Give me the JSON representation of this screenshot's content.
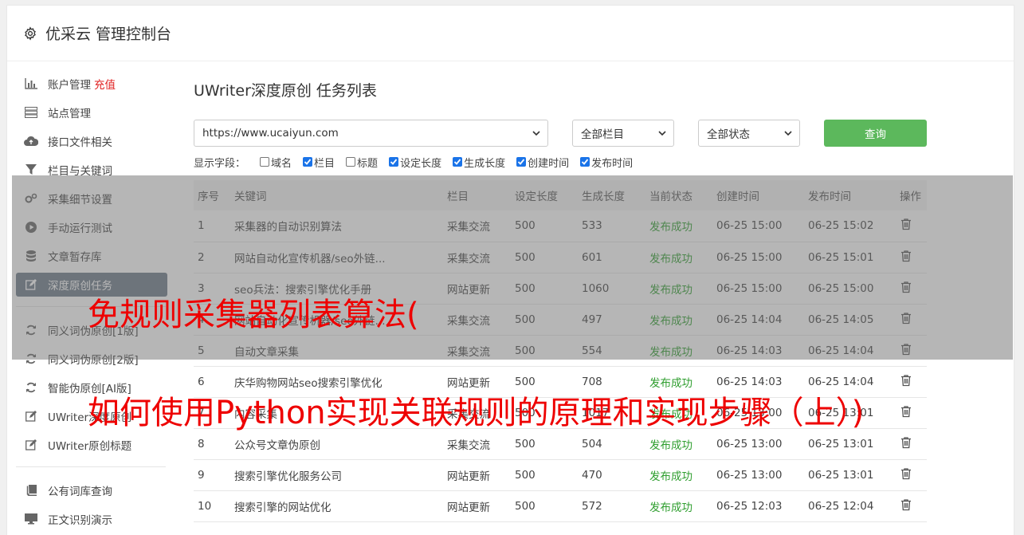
{
  "app": {
    "title": "优采云 管理控制台"
  },
  "sidebar": {
    "items": [
      {
        "label": "账户管理",
        "extra": "充值",
        "icon": "bar-chart-icon"
      },
      {
        "label": "站点管理",
        "icon": "server-icon"
      },
      {
        "label": "接口文件相关",
        "icon": "cloud-upload-icon"
      },
      {
        "label": "栏目与关键词",
        "icon": "filter-icon"
      },
      {
        "label": "采集细节设置",
        "icon": "gears-icon"
      },
      {
        "label": "手动运行测试",
        "icon": "play-icon"
      },
      {
        "label": "文章暂存库",
        "icon": "database-icon"
      },
      {
        "label": "深度原创任务",
        "icon": "edit-icon",
        "active": true
      }
    ],
    "items2": [
      {
        "label": "同义词伪原创[1版]",
        "icon": "refresh-icon"
      },
      {
        "label": "同义词伪原创[2版]",
        "icon": "refresh-icon"
      },
      {
        "label": "智能伪原创[AI版]",
        "icon": "refresh-icon"
      },
      {
        "label": "UWriter深度原创",
        "icon": "edit-icon"
      },
      {
        "label": "UWriter原创标题",
        "icon": "edit-icon"
      }
    ],
    "items3": [
      {
        "label": "公有词库查询",
        "icon": "book-icon"
      },
      {
        "label": "正文识别演示",
        "icon": "monitor-icon"
      }
    ]
  },
  "main": {
    "title": "UWriter深度原创 任务列表",
    "site_select": "https://www.ucaiyun.com",
    "column_select": "全部栏目",
    "status_select": "全部状态",
    "query_button": "查询",
    "fields_label": "显示字段：",
    "fields": [
      {
        "label": "域名",
        "checked": false
      },
      {
        "label": "栏目",
        "checked": true
      },
      {
        "label": "标题",
        "checked": false
      },
      {
        "label": "设定长度",
        "checked": true
      },
      {
        "label": "生成长度",
        "checked": true
      },
      {
        "label": "创建时间",
        "checked": true
      },
      {
        "label": "发布时间",
        "checked": true
      }
    ],
    "table": {
      "headers": [
        "序号",
        "关键词",
        "栏目",
        "设定长度",
        "生成长度",
        "当前状态",
        "创建时间",
        "发布时间",
        "操作"
      ],
      "rows": [
        [
          "1",
          "采集器的自动识别算法",
          "采集交流",
          "500",
          "533",
          "发布成功",
          "06-25 15:00",
          "06-25 15:02"
        ],
        [
          "2",
          "网站自动化宣传机器/seo外链...",
          "采集交流",
          "500",
          "601",
          "发布成功",
          "06-25 15:00",
          "06-25 15:01"
        ],
        [
          "3",
          "seo兵法：搜索引擎优化手册",
          "网站更新",
          "500",
          "1060",
          "发布成功",
          "06-25 15:00",
          "06-25 15:00"
        ],
        [
          "4",
          "网站自动化宣传机器/seo外链...",
          "采集交流",
          "500",
          "497",
          "发布成功",
          "06-25 14:04",
          "06-25 14:05"
        ],
        [
          "5",
          "自动文章采集",
          "采集交流",
          "500",
          "554",
          "发布成功",
          "06-25 14:03",
          "06-25 14:04"
        ],
        [
          "6",
          "庆华购物网站seo搜索引擎优化",
          "网站更新",
          "500",
          "708",
          "发布成功",
          "06-25 14:03",
          "06-25 14:04"
        ],
        [
          "7",
          "内容采集",
          "采集交流",
          "500",
          "1017",
          "发布成功",
          "06-25 13:00",
          "06-25 13:01"
        ],
        [
          "8",
          "公众号文章伪原创",
          "采集交流",
          "500",
          "504",
          "发布成功",
          "06-25 13:00",
          "06-25 13:01"
        ],
        [
          "9",
          "搜索引擎优化服务公司",
          "网站更新",
          "500",
          "470",
          "发布成功",
          "06-25 13:00",
          "06-25 13:01"
        ],
        [
          "10",
          "搜索引擎的网站优化",
          "网站更新",
          "500",
          "572",
          "发布成功",
          "06-25 12:03",
          "06-25 12:04"
        ]
      ]
    }
  },
  "watermark": {
    "line1": "免规则采集器列表算法(",
    "line2": "如何使用Python实现关联规则的原理和实现步骤（上）)"
  },
  "colors": {
    "accent_green": "#5cb85c",
    "status_ok": "#2e9e2e",
    "active_sidebar": "#6d7a89",
    "watermark": "#ee0000"
  }
}
